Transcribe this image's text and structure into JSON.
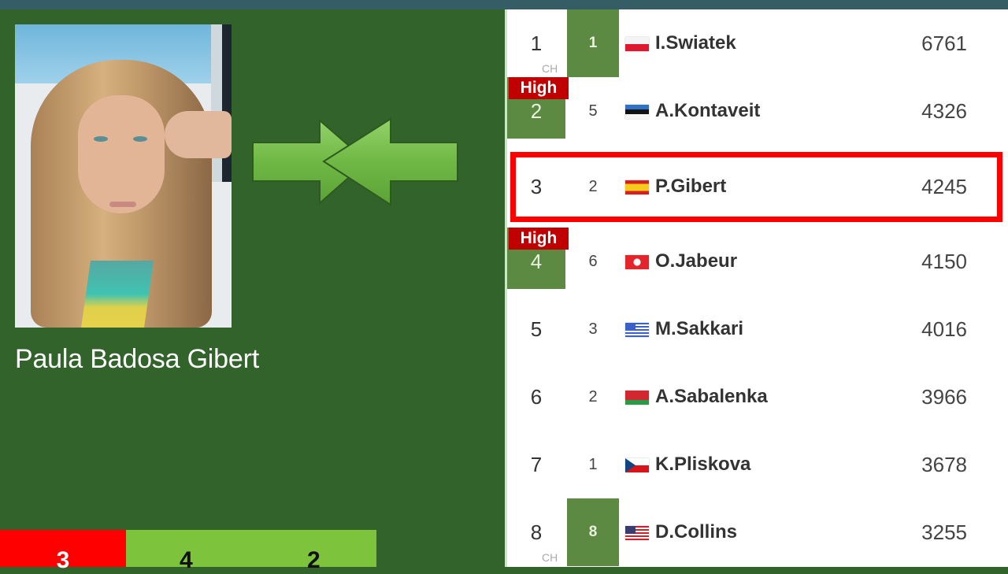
{
  "player": {
    "full_name": "Paula Badosa Gibert",
    "photo_alt": "player-photo"
  },
  "bottom_boxes": {
    "red_value": "3",
    "green_values": [
      "4",
      "2"
    ],
    "colors": {
      "red": "#ff0000",
      "green": "#7dc33b"
    }
  },
  "colors": {
    "background": "#32632a",
    "topbar": "#355d66",
    "rank_green": "#5d8a42",
    "high_badge": "#c00000",
    "highlight_border": "#ff0000"
  },
  "ranking": {
    "highlighted_player": "P.Gibert",
    "rows": [
      {
        "rank": "1",
        "rank_note": "CH",
        "change": "1",
        "change_highlight": true,
        "high": false,
        "rank_highlight": false,
        "flag": "poland",
        "name": "I.Swiatek",
        "points": "6761"
      },
      {
        "rank": "2",
        "rank_note": "",
        "change": "5",
        "change_highlight": false,
        "high": true,
        "high_label": "High",
        "rank_highlight": true,
        "flag": "estonia",
        "name": "A.Kontaveit",
        "points": "4326"
      },
      {
        "rank": "3",
        "rank_note": "",
        "change": "2",
        "change_highlight": false,
        "high": false,
        "rank_highlight": false,
        "flag": "spain",
        "name": "P.Gibert",
        "points": "4245"
      },
      {
        "rank": "4",
        "rank_note": "",
        "change": "6",
        "change_highlight": false,
        "high": true,
        "high_label": "High",
        "rank_highlight": true,
        "flag": "tunisia",
        "name": "O.Jabeur",
        "points": "4150"
      },
      {
        "rank": "5",
        "rank_note": "",
        "change": "3",
        "change_highlight": false,
        "high": false,
        "rank_highlight": false,
        "flag": "greece",
        "name": "M.Sakkari",
        "points": "4016"
      },
      {
        "rank": "6",
        "rank_note": "",
        "change": "2",
        "change_highlight": false,
        "high": false,
        "rank_highlight": false,
        "flag": "belarus",
        "name": "A.Sabalenka",
        "points": "3966"
      },
      {
        "rank": "7",
        "rank_note": "",
        "change": "1",
        "change_highlight": false,
        "high": false,
        "rank_highlight": false,
        "flag": "czech-republic",
        "name": "K.Pliskova",
        "points": "3678"
      },
      {
        "rank": "8",
        "rank_note": "CH",
        "change": "8",
        "change_highlight": true,
        "high": false,
        "rank_highlight": false,
        "flag": "usa",
        "name": "D.Collins",
        "points": "3255"
      }
    ]
  }
}
